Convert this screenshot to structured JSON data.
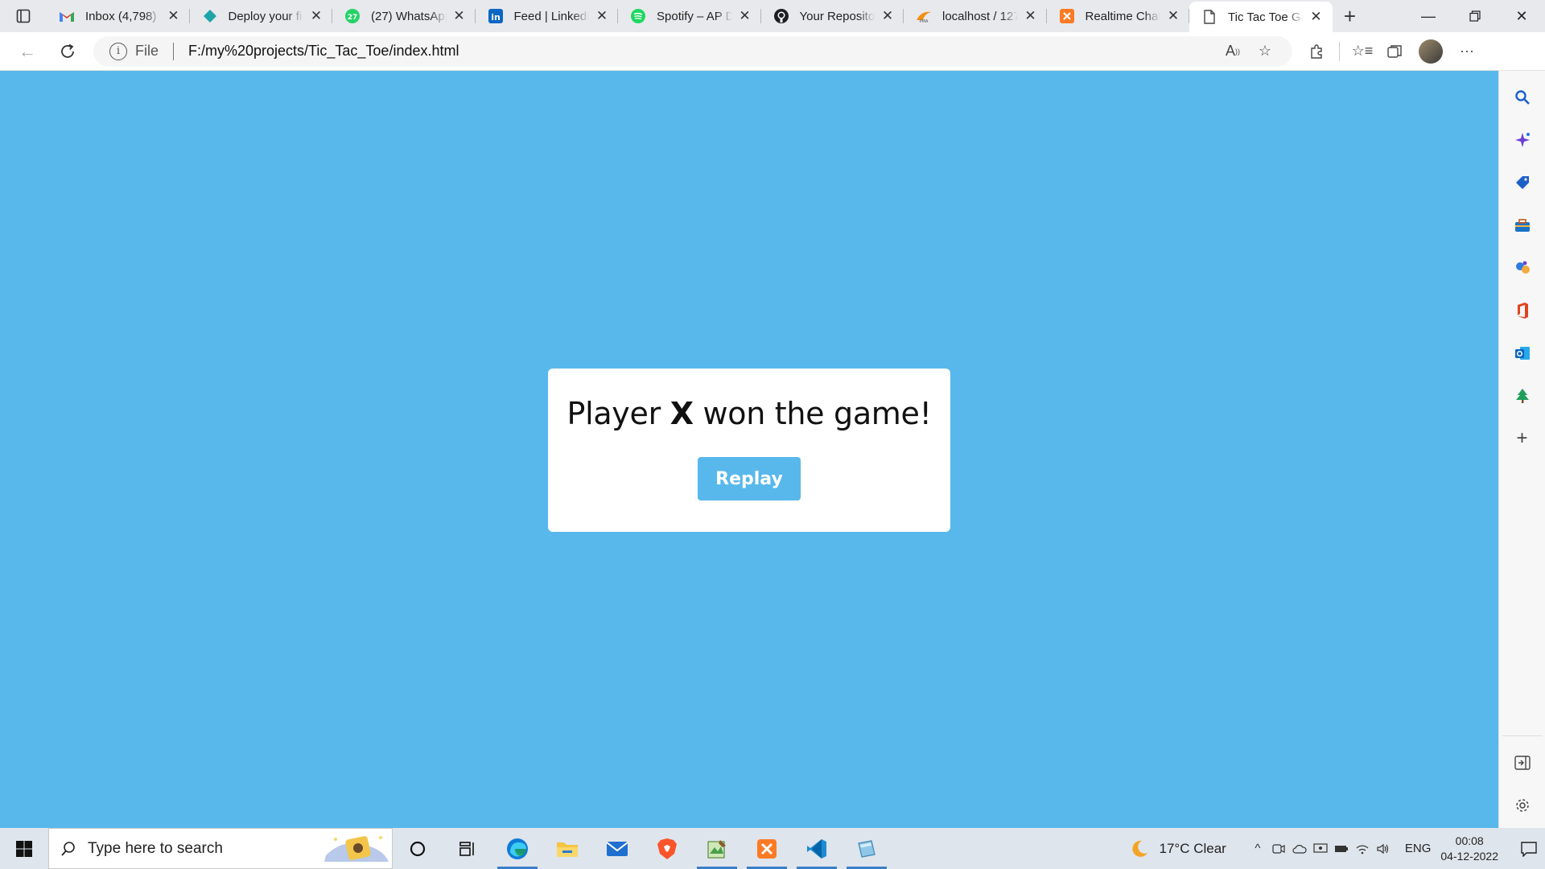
{
  "browser": {
    "tabs": [
      {
        "title": "Inbox (4,798) -",
        "icon": "gmail-icon",
        "active": false
      },
      {
        "title": "Deploy your fi",
        "icon": "deploy-diamond-icon",
        "active": false
      },
      {
        "title": "(27) WhatsApp",
        "icon": "whatsapp-icon",
        "active": false
      },
      {
        "title": "Feed | LinkedIn",
        "icon": "linkedin-icon",
        "active": false
      },
      {
        "title": "Spotify – AP D",
        "icon": "spotify-icon",
        "active": false
      },
      {
        "title": "Your Repositor",
        "icon": "github-icon",
        "active": false
      },
      {
        "title": "localhost / 127",
        "icon": "phpmyadmin-icon",
        "active": false
      },
      {
        "title": "Realtime Chat",
        "icon": "xampp-icon",
        "active": false
      },
      {
        "title": "Tic Tac Toe Ga",
        "icon": "page-icon",
        "active": true
      }
    ],
    "address": {
      "scheme": "File",
      "url": "F:/my%20projects/Tic_Tac_Toe/index.html"
    }
  },
  "game": {
    "result_prefix": "Player ",
    "winner": "X",
    "result_suffix": " won the game!",
    "replay_label": "Replay",
    "background_color": "#58b8ec"
  },
  "taskbar": {
    "search_placeholder": "Type here to search",
    "weather": "17°C  Clear",
    "language": "ENG",
    "time": "00:08",
    "date": "04-12-2022"
  }
}
